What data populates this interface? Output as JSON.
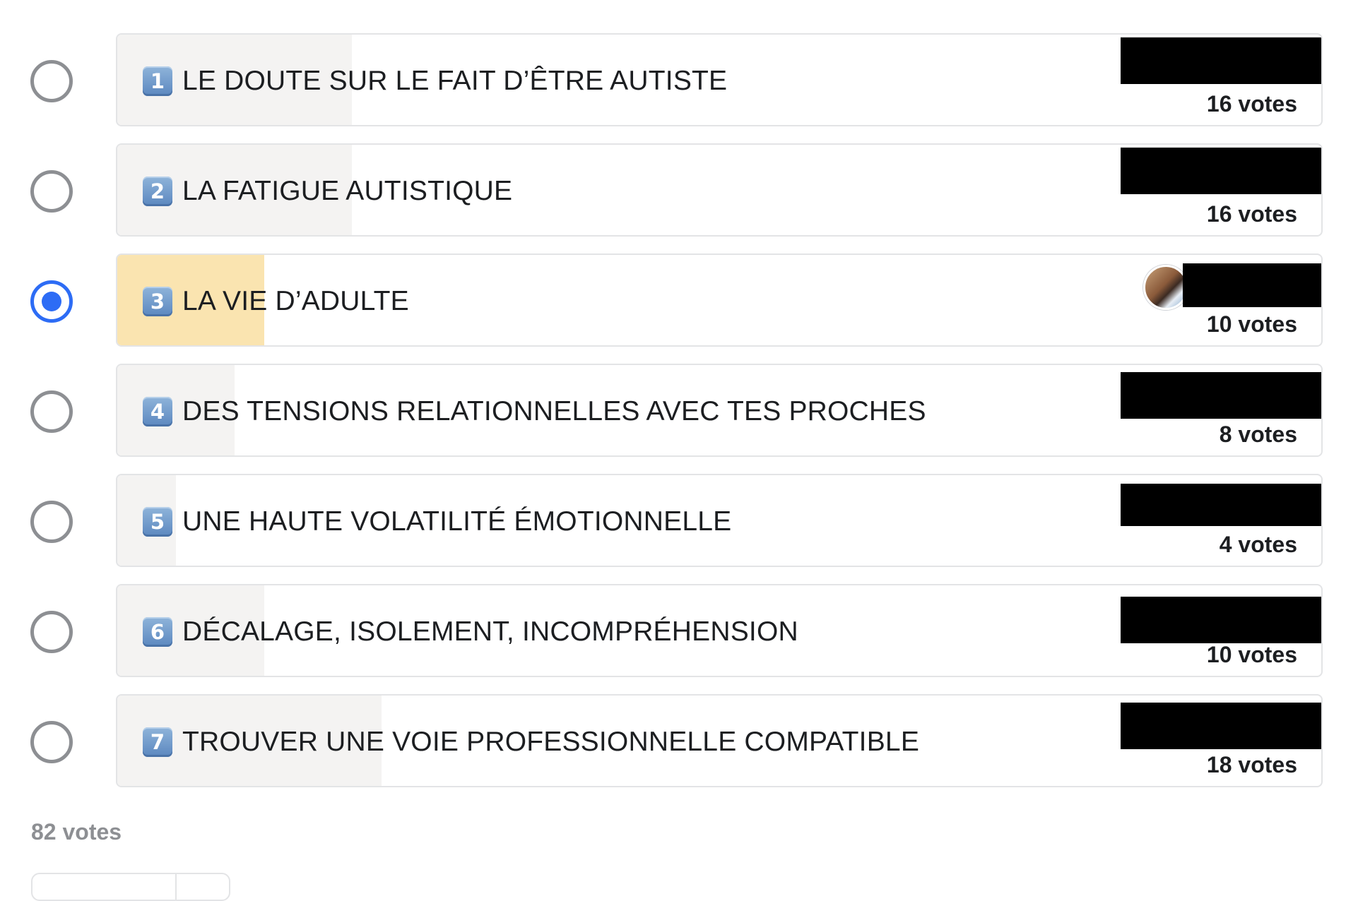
{
  "poll": {
    "options": [
      {
        "number": "1",
        "label": "LE DOUTE SUR LE FAIT D’ÊTRE AUTISTE",
        "votes": 16,
        "votes_text": "16 votes",
        "selected": false,
        "share": 0.1951
      },
      {
        "number": "2",
        "label": "LA FATIGUE AUTISTIQUE",
        "votes": 16,
        "votes_text": "16 votes",
        "selected": false,
        "share": 0.1951
      },
      {
        "number": "3",
        "label": "LA VIE D’ADULTE",
        "votes": 10,
        "votes_text": "10 votes",
        "selected": true,
        "share": 0.122
      },
      {
        "number": "4",
        "label": "DES TENSIONS RELATIONNELLES AVEC TES PROCHES",
        "votes": 8,
        "votes_text": "8 votes",
        "selected": false,
        "share": 0.0976
      },
      {
        "number": "5",
        "label": "UNE HAUTE VOLATILITÉ ÉMOTIONNELLE",
        "votes": 4,
        "votes_text": "4 votes",
        "selected": false,
        "share": 0.0488
      },
      {
        "number": "6",
        "label": "DÉCALAGE, ISOLEMENT, INCOMPRÉHENSION",
        "votes": 10,
        "votes_text": "10 votes",
        "selected": false,
        "share": 0.122
      },
      {
        "number": "7",
        "label": "TROUVER UNE VOIE PROFESSIONNELLE COMPATIBLE",
        "votes": 18,
        "votes_text": "18 votes",
        "selected": false,
        "share": 0.2195
      }
    ],
    "total_votes_text": "82 votes"
  },
  "colors": {
    "accent_blue": "#2d6cf5",
    "selected_fill": "#fae4b0",
    "unselected_fill": "#f4f3f2",
    "border": "#e3e4e6",
    "muted_text": "#8d8f93"
  },
  "icons": {
    "number_badge": "keycap-number-icon",
    "voter_avatar": "voter-avatar-icon"
  }
}
